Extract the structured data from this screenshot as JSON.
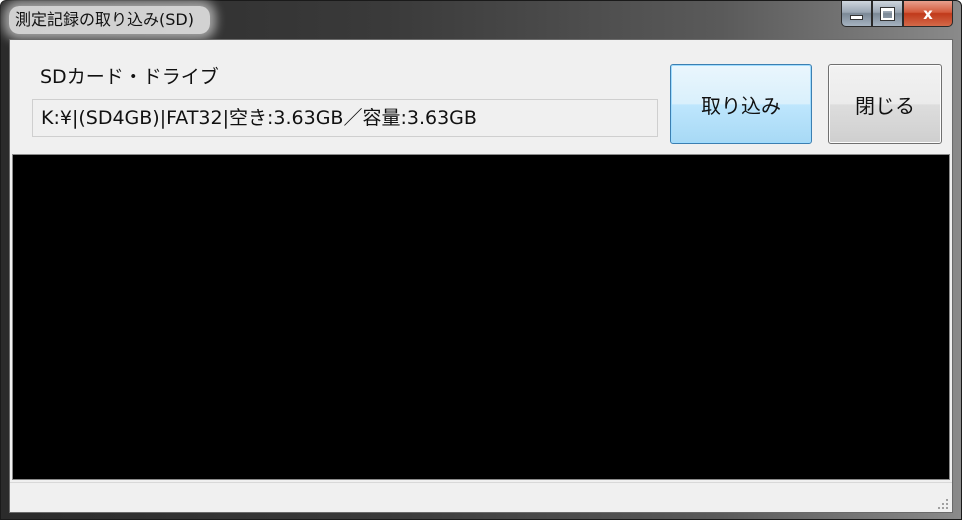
{
  "window": {
    "title": "測定記録の取り込み(SD)"
  },
  "caption": {
    "close_glyph": "x"
  },
  "drive": {
    "label": "SDカード・ドライブ",
    "value": "K:¥|(SD4GB)|FAT32|空き:3.63GB／容量:3.63GB"
  },
  "buttons": {
    "import_label": "取り込み",
    "close_label": "閉じる"
  },
  "log": {
    "background_color": "#000000"
  },
  "status": {
    "text": ""
  }
}
